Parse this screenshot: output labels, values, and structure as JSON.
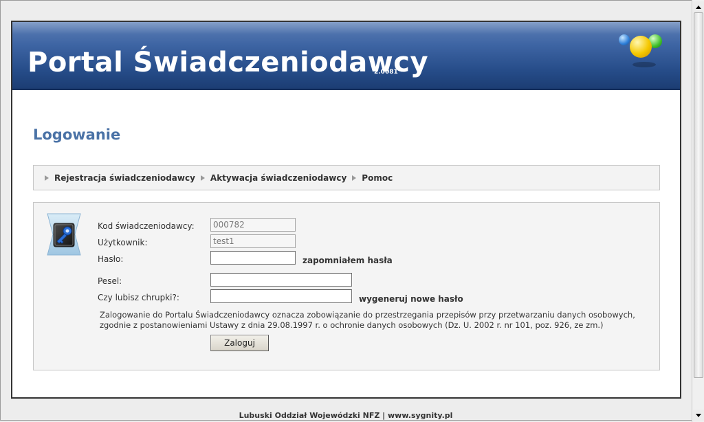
{
  "header": {
    "title": "Portal Świadczeniodawcy",
    "version": "2.0081"
  },
  "page": {
    "heading": "Logowanie"
  },
  "nav": {
    "items": [
      {
        "label": "Rejestracja świadczeniodawcy"
      },
      {
        "label": "Aktywacja świadczeniodawcy"
      },
      {
        "label": "Pomoc"
      }
    ]
  },
  "form": {
    "provider_code_label": "Kod świadczeniodawcy:",
    "provider_code_value": "000782",
    "user_label": "Użytkownik:",
    "user_value": "test1",
    "password_label": "Hasło:",
    "password_value": "",
    "forgot_password": "zapomniałem hasła",
    "pesel_label": "Pesel:",
    "pesel_value": "",
    "question_label": "Czy lubisz chrupki?:",
    "question_value": "",
    "generate_password": "wygeneruj nowe hasło",
    "notice": "Zalogowanie do Portalu Świadczeniodawcy oznacza zobowiązanie do przestrzegania przepisów przy przetwarzaniu danych osobowych, zgodnie z postanowieniami Ustawy z dnia 29.08.1997 r. o ochronie danych osobowych (Dz. U. 2002 r. nr 101, poz. 926, ze zm.)",
    "login_button": "Zaloguj"
  },
  "footer": {
    "text": "Lubuski Oddział Wojewódzki NFZ | www.sygnity.pl"
  },
  "colors": {
    "header_blue": "#254b87",
    "heading_blue": "#4a72a6"
  },
  "icons": {
    "login": "key-card-icon",
    "nav_bullet": "triangle-right-icon"
  }
}
